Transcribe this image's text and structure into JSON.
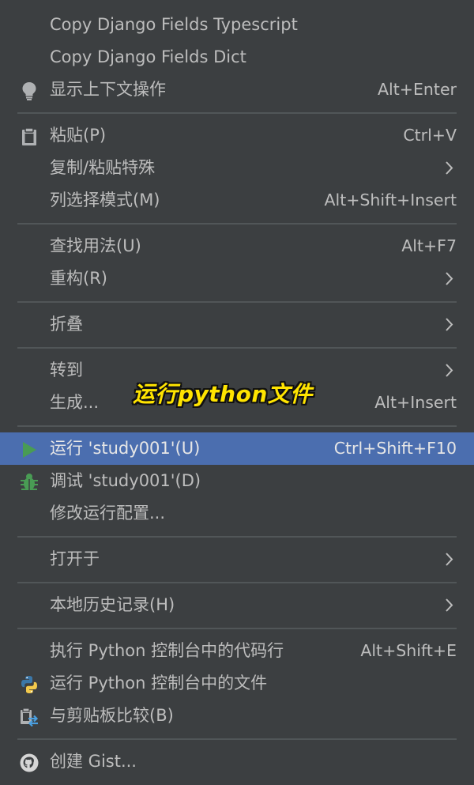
{
  "menu": {
    "group1": {
      "copy_ts": {
        "label": "Copy Django Fields Typescript"
      },
      "copy_dict": {
        "label": "Copy Django Fields Dict"
      },
      "context_actions": {
        "label": "显示上下文操作",
        "shortcut": "Alt+Enter",
        "icon": "lightbulb-icon"
      }
    },
    "group2": {
      "paste": {
        "label": "粘贴(P)",
        "shortcut": "Ctrl+V",
        "icon": "clipboard-icon"
      },
      "copy_paste_special": {
        "label": "复制/粘贴特殊"
      },
      "column_mode": {
        "label": "列选择模式(M)",
        "shortcut": "Alt+Shift+Insert"
      }
    },
    "group3": {
      "find_usages": {
        "label": "查找用法(U)",
        "shortcut": "Alt+F7"
      },
      "refactor": {
        "label": "重构(R)"
      }
    },
    "group4": {
      "folding": {
        "label": "折叠"
      }
    },
    "group5": {
      "goto": {
        "label": "转到"
      },
      "generate": {
        "label": "生成...",
        "shortcut": "Alt+Insert"
      }
    },
    "group6": {
      "run": {
        "label": "运行 'study001'(U)",
        "shortcut": "Ctrl+Shift+F10",
        "icon": "run-play-icon"
      },
      "debug": {
        "label": "调试 'study001'(D)",
        "icon": "debug-bug-icon"
      },
      "modify_config": {
        "label": "修改运行配置..."
      }
    },
    "group7": {
      "open_in": {
        "label": "打开于"
      }
    },
    "group8": {
      "local_history": {
        "label": "本地历史记录(H)"
      }
    },
    "group9": {
      "exec_in_console": {
        "label": "执行 Python 控制台中的代码行",
        "shortcut": "Alt+Shift+E"
      },
      "run_file_in_console": {
        "label": "运行 Python 控制台中的文件",
        "icon": "python-icon"
      },
      "compare_clipboard": {
        "label": "与剪贴板比较(B)",
        "icon": "compare-clipboard-icon"
      }
    },
    "group10": {
      "create_gist": {
        "label": "创建 Gist...",
        "icon": "github-icon"
      }
    }
  },
  "annotation": {
    "text": "运行python文件",
    "color": "#ffe400"
  },
  "colors": {
    "background": "#3c3f41",
    "text": "#bdbdbd",
    "selected_bg": "#4b6eaf",
    "separator": "#515658",
    "run_icon": "#499c54",
    "debug_icon": "#499c54"
  }
}
